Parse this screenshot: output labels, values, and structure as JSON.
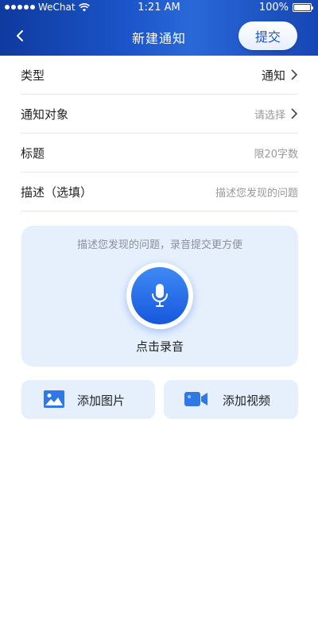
{
  "statusbar": {
    "carrier": "WeChat",
    "time": "1:21 AM",
    "battery": "100%"
  },
  "header": {
    "title": "新建通知",
    "submit_label": "提交"
  },
  "form": {
    "rows": [
      {
        "label": "类型",
        "value": "通知"
      },
      {
        "label": "通知对象",
        "placeholder": "请选择"
      },
      {
        "label": "标题",
        "placeholder": "限20字数"
      },
      {
        "label": "描述（选填）",
        "placeholder": "描述您发现的问题"
      }
    ]
  },
  "voice": {
    "hint": "描述您发现的问题，录音提交更方便",
    "label": "点击录音"
  },
  "media": {
    "photo_label": "添加图片",
    "video_label": "添加视频"
  },
  "colors": {
    "header_blue": "#1b55c9",
    "accent": "#1a54c7",
    "card_bg": "#e6f0fd"
  },
  "icons": [
    "wifi-icon",
    "battery-icon",
    "back-icon",
    "chevron-right-icon",
    "microphone-icon",
    "image-icon",
    "video-camera-icon"
  ]
}
